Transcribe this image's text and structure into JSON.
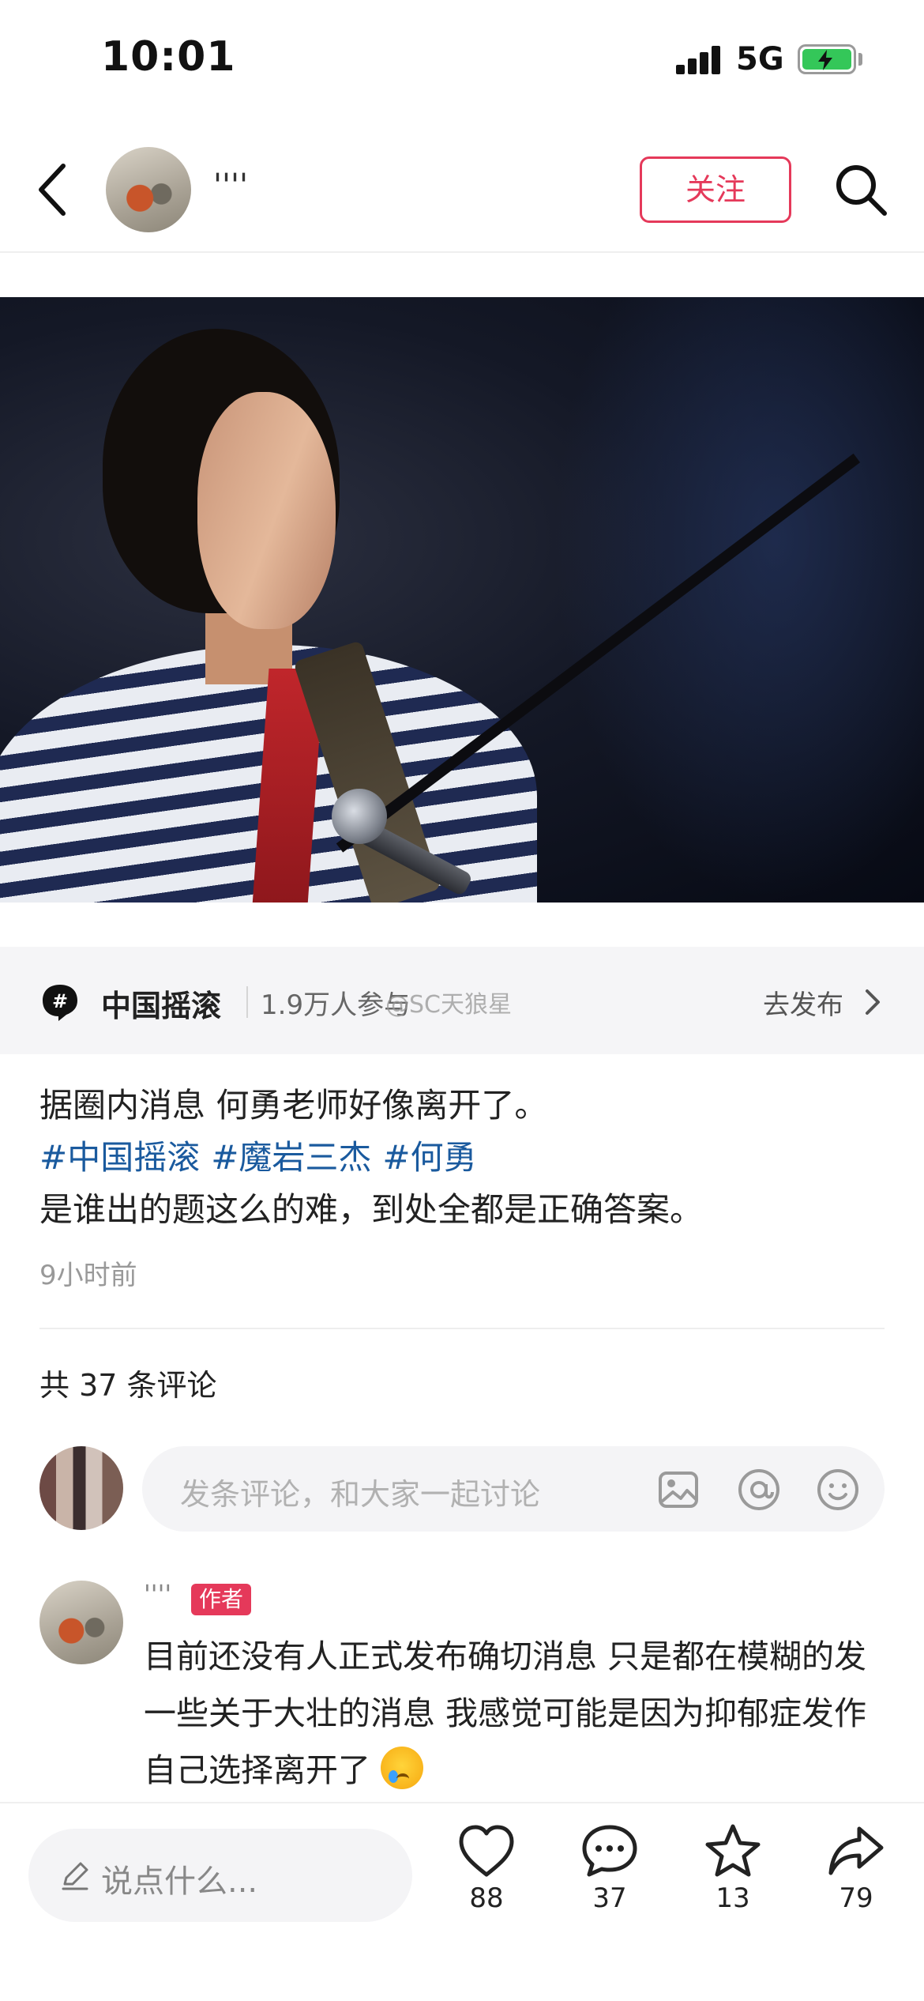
{
  "status_bar": {
    "time": "10:01",
    "network": "5G"
  },
  "header": {
    "author_name": "''''",
    "follow_label": "关注"
  },
  "topic": {
    "name": "中国摇滚",
    "participants": "1.9万人参与",
    "watermark": "@SC天狼星",
    "go_publish": "去发布"
  },
  "post": {
    "line1": "据圈内消息 何勇老师好像离开了。",
    "tags": [
      "#中国摇滚",
      "#魔岩三杰",
      "#何勇"
    ],
    "line3": "是谁出的题这么的难，到处全都是正确答案。",
    "time": "9小时前"
  },
  "comments": {
    "count_label": "共 37 条评论",
    "input_placeholder": "发条评论，和大家一起讨论",
    "items": [
      {
        "author": "''''",
        "badge": "作者",
        "text": "目前还没有人正式发布确切消息 只是都在模糊的发一些关于大壮的消息 我感觉可能是因为抑郁症发作 自己选择离开了"
      }
    ]
  },
  "bottom_bar": {
    "input_placeholder": "说点什么...",
    "likes": "88",
    "comments": "37",
    "stars": "13",
    "shares": "79"
  },
  "colors": {
    "accent": "#e5395a",
    "hashtag": "#1a5a9e",
    "battery": "#34c759"
  }
}
